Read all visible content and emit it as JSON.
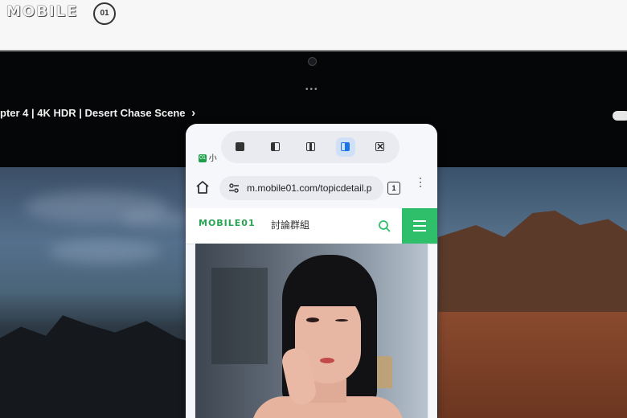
{
  "watermark": {
    "text": "MOBILE",
    "badge": "01"
  },
  "video": {
    "title": "pter 4 | 4K HDR | Desert Chase Scene",
    "chevron": "›"
  },
  "floating_window": {
    "window_controls": [
      {
        "name": "fullscreen-mode",
        "icon": "fullscreen-icon",
        "active": false
      },
      {
        "name": "split-left-mode",
        "icon": "split-left-icon",
        "active": false
      },
      {
        "name": "split-center-mode",
        "icon": "split-center-icon",
        "active": false
      },
      {
        "name": "floating-mode",
        "icon": "floating-window-icon",
        "active": true
      },
      {
        "name": "close-window",
        "icon": "close-icon",
        "active": false
      }
    ],
    "close_glyph": "✕",
    "tab": {
      "icon_text": "01",
      "label": "小"
    },
    "browser": {
      "url": "m.mobile01.com/topicdetail.p",
      "tabs_count": "1",
      "menu_glyph": "⋮"
    },
    "site": {
      "logo": "MOBILE01",
      "section": "討論群組"
    }
  },
  "colors": {
    "brand_green": "#2fbf6a",
    "active_blue": "#1a73e8"
  }
}
